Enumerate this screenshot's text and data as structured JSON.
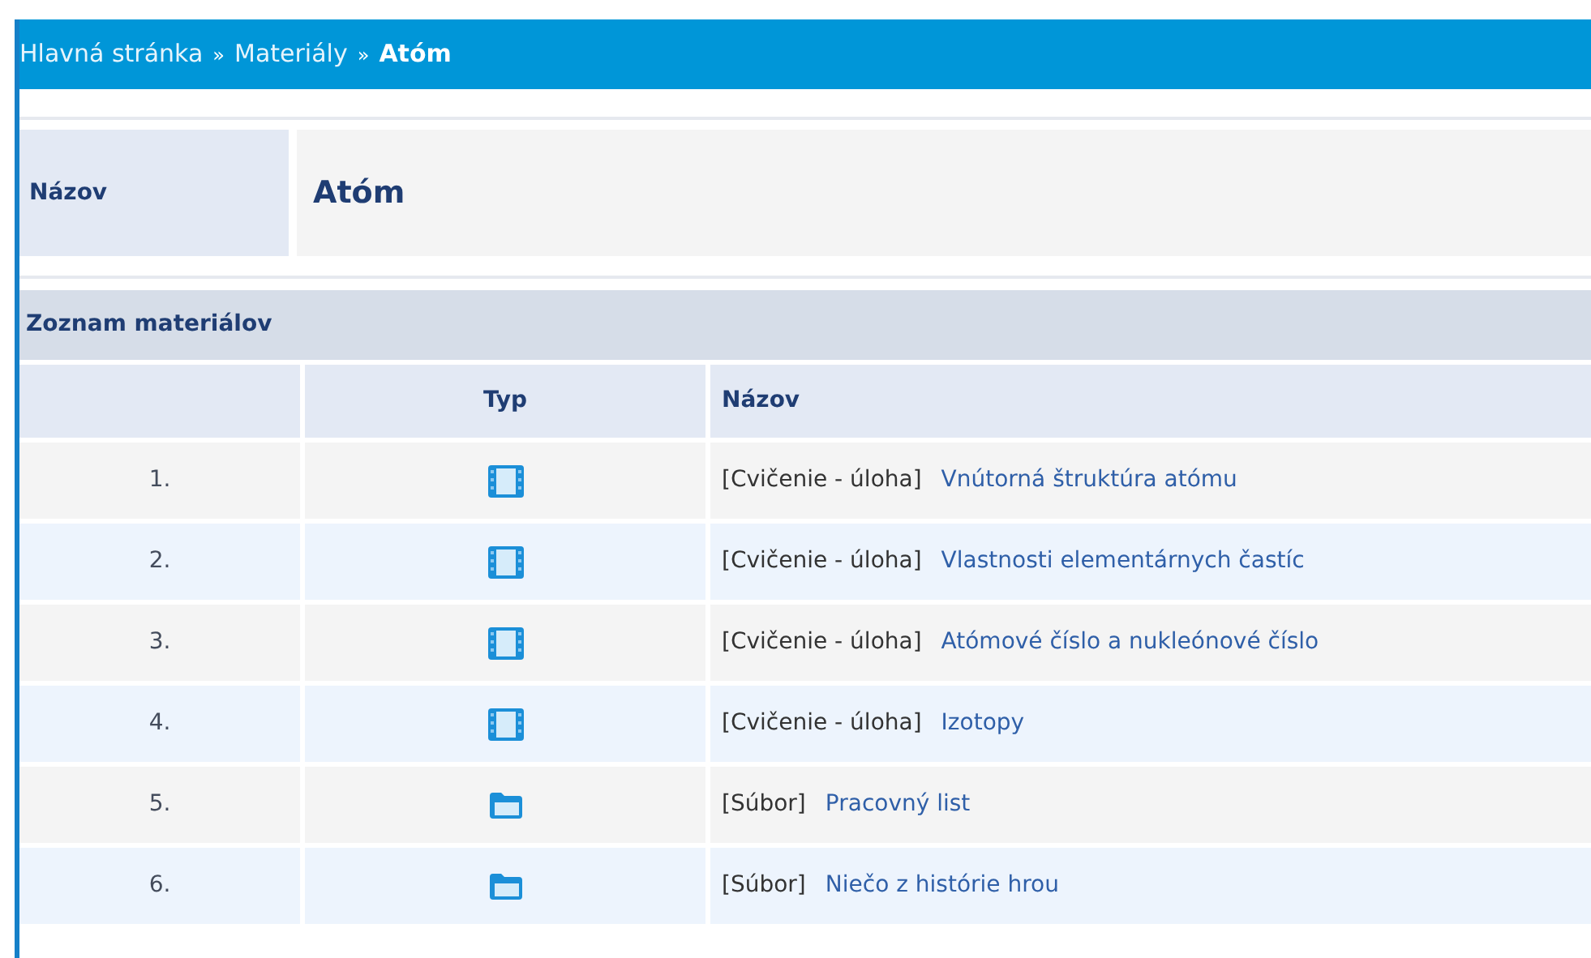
{
  "breadcrumb": {
    "items": [
      {
        "label": "Hlavná stránka",
        "current": false
      },
      {
        "label": "Materiály",
        "current": false
      },
      {
        "label": "Atóm",
        "current": true
      }
    ],
    "separator": "»"
  },
  "detail": {
    "label": "Názov",
    "value": "Atóm"
  },
  "materials": {
    "title": "Zoznam materiálov",
    "columns": [
      "Typ",
      "Názov"
    ],
    "rows": [
      {
        "number": "1.",
        "kind": "exercise",
        "type": "[Cvičenie - úloha]",
        "title": "Vnútorná štruktúra atómu"
      },
      {
        "number": "2.",
        "kind": "exercise",
        "type": "[Cvičenie - úloha]",
        "title": "Vlastnosti elementárnych častíc"
      },
      {
        "number": "3.",
        "kind": "exercise",
        "type": "[Cvičenie - úloha]",
        "title": "Atómové číslo a nukleónové číslo"
      },
      {
        "number": "4.",
        "kind": "exercise",
        "type": "[Cvičenie - úloha]",
        "title": "Izotopy"
      },
      {
        "number": "5.",
        "kind": "file",
        "type": "[Súbor]",
        "title": "Pracovný list"
      },
      {
        "number": "6.",
        "kind": "file",
        "type": "[Súbor]",
        "title": "Niečo z histórie hrou"
      }
    ]
  }
}
